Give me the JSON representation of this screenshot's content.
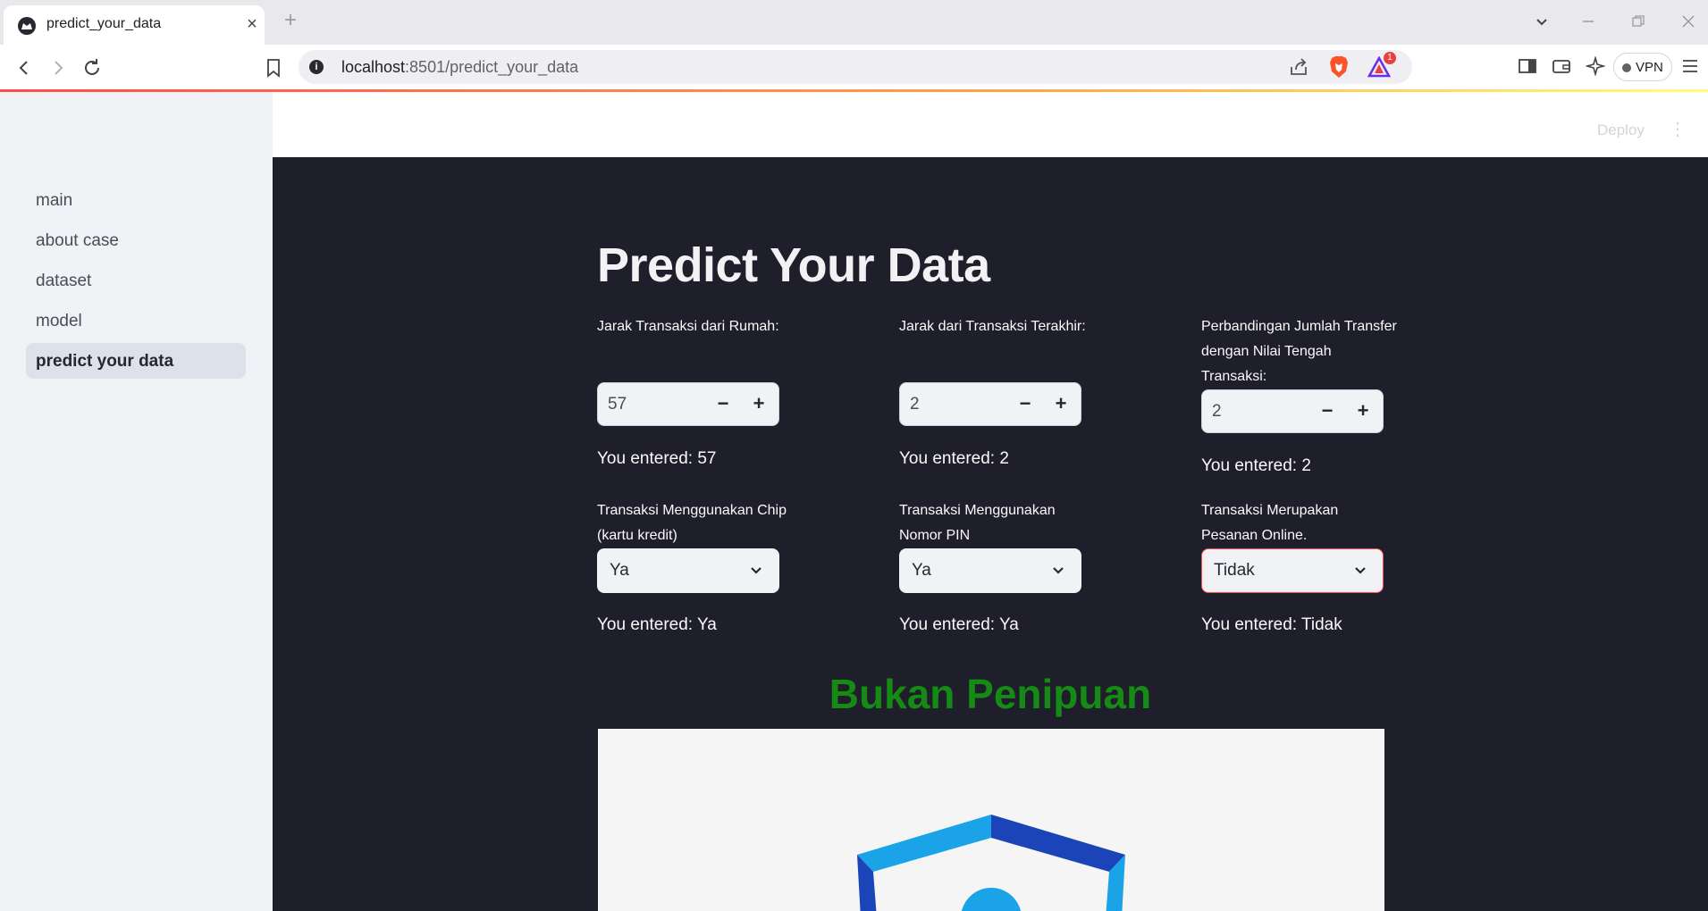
{
  "browser": {
    "tab_title": "predict_your_data",
    "new_tab_symbol": "+",
    "url_host": "localhost",
    "url_path": ":8501/predict_your_data",
    "rewards_badge": "1",
    "vpn_label": "VPN"
  },
  "sidebar": {
    "items": [
      {
        "label": "main"
      },
      {
        "label": "about case"
      },
      {
        "label": "dataset"
      },
      {
        "label": "model"
      },
      {
        "label": "predict your data",
        "active": true
      }
    ]
  },
  "header": {
    "deploy_label": "Deploy",
    "menu_symbol": "⋮"
  },
  "main": {
    "title": "Predict Your Data",
    "inputs": [
      {
        "label": "Jarak Transaksi dari Rumah:",
        "value": "57",
        "echo": "You entered: 57"
      },
      {
        "label": "Jarak dari Transaksi Terakhir:",
        "value": "2",
        "echo": "You entered: 2"
      },
      {
        "label": "Perbandingan Jumlah Transfer dengan Nilai Tengah Transaksi:",
        "value": "2",
        "echo": "You entered: 2"
      }
    ],
    "stepper_minus": "−",
    "stepper_plus": "+",
    "selects": [
      {
        "label": "Transaksi Menggunakan Chip (kartu kredit)",
        "value": "Ya",
        "echo": "You entered: Ya"
      },
      {
        "label": "Transaksi Menggunakan Nomor PIN",
        "value": "Ya",
        "echo": "You entered: Ya"
      },
      {
        "label": "Transaksi Merupakan Pesanan Online.",
        "value": "Tidak",
        "echo": "You entered: Tidak"
      }
    ],
    "result": "Bukan Penipuan",
    "result_color": "#158a15"
  },
  "colors": {
    "main_bg": "#1f1e2b",
    "sidebar_bg": "#f0f2f6",
    "accent": "#ff4b4b",
    "shield_light": "#1aa3e6",
    "shield_dark": "#1a44b8"
  },
  "icons": [
    "back-icon",
    "forward-icon",
    "reload-icon",
    "bookmark-icon",
    "share-icon",
    "brave-lion-icon",
    "brave-rewards-icon",
    "sidebar-icon",
    "wallet-icon",
    "leo-ai-icon",
    "menu-icon",
    "shield-icon"
  ]
}
